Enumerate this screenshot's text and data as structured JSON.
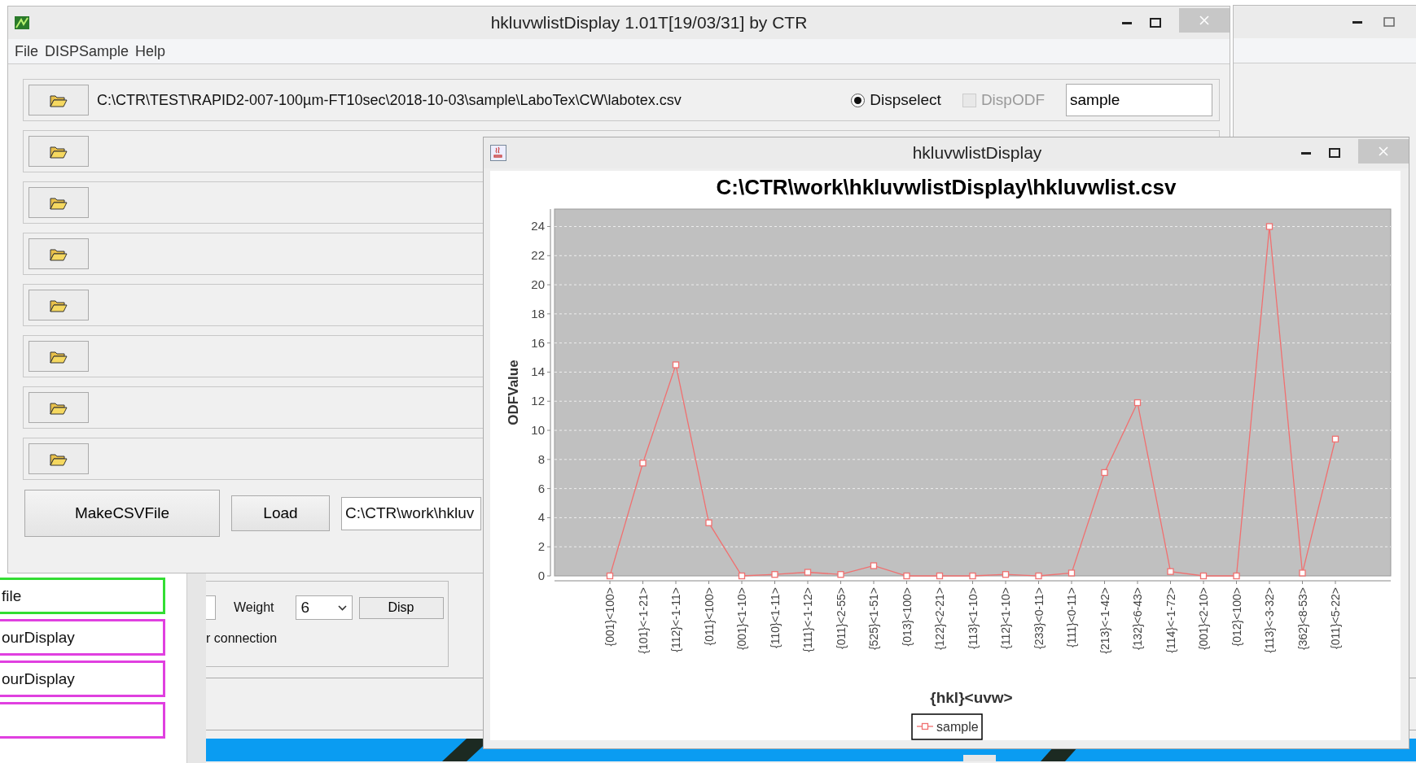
{
  "main_window": {
    "title": "hkluvwlistDisplay 1.01T[19/03/31] by CTR",
    "menu": [
      "File",
      "DISPSample",
      "Help"
    ],
    "file_rows": [
      {
        "kind": "full",
        "path": "C:\\CTR\\TEST\\RAPID2-007-100µm-FT10sec\\2018-10-03\\sample\\LaboTex\\CW\\labotex.csv",
        "dispselect": {
          "label": "Dispselect",
          "selected": true
        },
        "dispodf": {
          "label": "DispODF",
          "checked": false,
          "disabled": true
        },
        "name_field": "sample"
      },
      {
        "kind": "button_only"
      },
      {
        "kind": "button_only"
      },
      {
        "kind": "button_only"
      },
      {
        "kind": "button_only"
      },
      {
        "kind": "button_only"
      },
      {
        "kind": "button_only"
      },
      {
        "kind": "button_only"
      }
    ],
    "make_csv_button": "MakeCSVFile",
    "load_button": "Load",
    "output_path": "C:\\CTR\\work\\hkluv"
  },
  "chart_window": {
    "title": "hkluvwlistDisplay",
    "chart_data": {
      "type": "line",
      "title": "C:\\CTR\\work\\hkluvwlistDisplay\\hkluvwlist.csv",
      "xlabel": "{hkl}<uvw>",
      "ylabel": "ODFValue",
      "categories": [
        "{001}<100>",
        "{101}<-1-21>",
        "{112}<-1-11>",
        "{011}<100>",
        "{001}<1-10>",
        "{110}<1-11>",
        "{111}<-1-12>",
        "{011}<2-55>",
        "{525}<1-51>",
        "{013}<100>",
        "{122}<2-21>",
        "{113}<1-10>",
        "{112}<1-10>",
        "{233}<0-11>",
        "{111}<0-11>",
        "{213}<-1-42>",
        "{132}<6-43>",
        "{114}<-1-72>",
        "{001}<2-10>",
        "{012}<100>",
        "{113}<-3-32>",
        "{362}<8-53>",
        "{011}<5-22>"
      ],
      "grid": true,
      "series": [
        {
          "name": "sample",
          "color": "#f07070",
          "marker": "square",
          "values": [
            0,
            7.75,
            14.5,
            3.65,
            0,
            0.1,
            0.25,
            0.1,
            0.7,
            0,
            0,
            0,
            0.1,
            0,
            0.2,
            7.1,
            11.9,
            0.3,
            0,
            0,
            24,
            0.2,
            9.4
          ]
        }
      ],
      "ylim": [
        0,
        25.2
      ],
      "yticks": [
        0,
        2,
        4,
        6,
        8,
        10,
        12,
        14,
        16,
        18,
        20,
        22,
        24
      ]
    }
  },
  "list_window": {
    "items": [
      {
        "text": "file",
        "color": "#33dd33"
      },
      {
        "text": "ourDisplay",
        "color": "#e040e0"
      },
      {
        "text": "ourDisplay",
        "color": "#e040e0"
      },
      {
        "color": "#e040e0"
      }
    ]
  },
  "settings_window": {
    "weight_label": "Weight",
    "weight_value": "6",
    "disp_button": "Disp",
    "connection_text": "r connection"
  }
}
